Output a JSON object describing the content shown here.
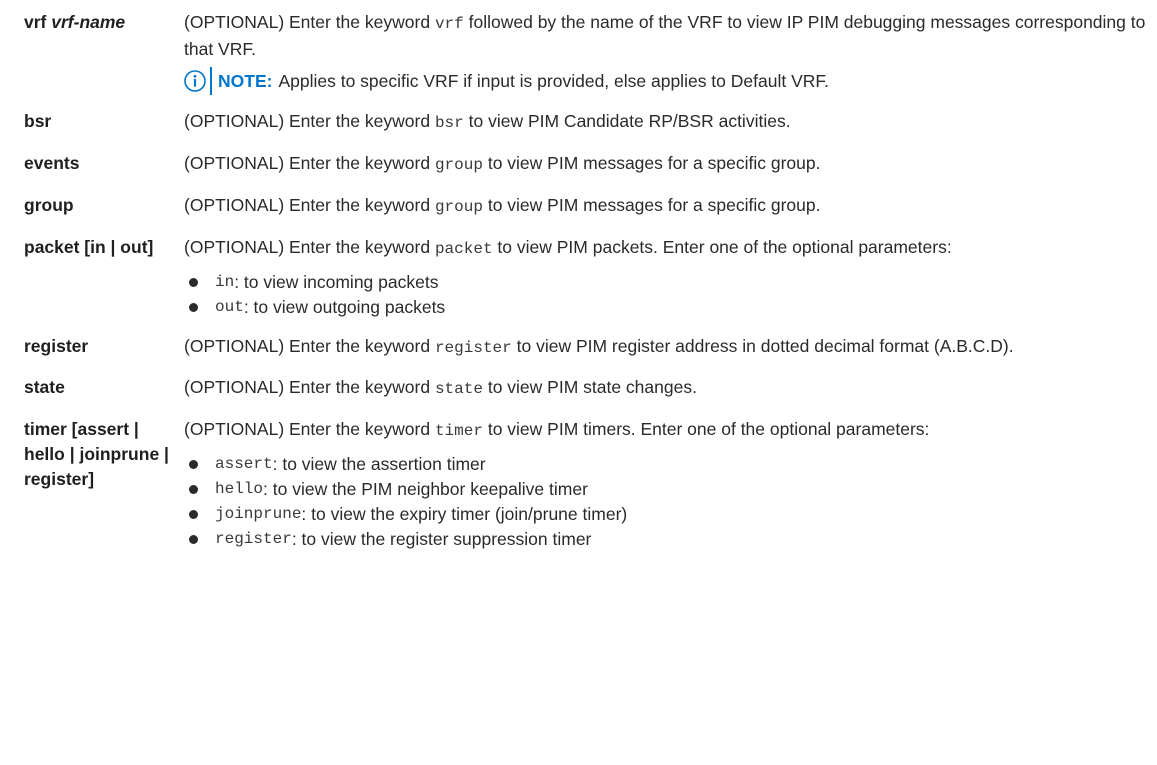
{
  "colors": {
    "note_accent": "#0076ce",
    "text": "#2a2a2a"
  },
  "rows": {
    "vrf": {
      "term_keyword": "vrf",
      "term_arg": "vrf-name",
      "desc_a": "(OPTIONAL) Enter the keyword",
      "desc_code": "vrf",
      "desc_b": "followed by the name of the VRF to view IP PIM debugging messages corresponding to that VRF.",
      "note_icon": "info-circle-icon",
      "note_label": "NOTE:",
      "note_text": "Applies to specific VRF if input is provided, else applies to Default VRF."
    },
    "bsr": {
      "term": "bsr",
      "desc_a": "(OPTIONAL) Enter the keyword",
      "desc_code": "bsr",
      "desc_b": "to view PIM Candidate RP/BSR activities."
    },
    "events": {
      "term": "events",
      "desc_a": "(OPTIONAL) Enter the keyword",
      "desc_code": "group",
      "desc_b": "to view PIM messages for a specific group."
    },
    "group": {
      "term": "group",
      "desc_a": "(OPTIONAL) Enter the keyword",
      "desc_code": "group",
      "desc_b": "to view PIM messages for a specific group."
    },
    "packet": {
      "term": "packet [in | out]",
      "desc_a": "(OPTIONAL) Enter the keyword",
      "desc_code": "packet",
      "desc_b": "to view PIM packets. Enter one of the optional parameters:",
      "options": [
        {
          "code": "in",
          "text": ": to view incoming packets"
        },
        {
          "code": "out",
          "text": ": to view outgoing packets"
        }
      ]
    },
    "register": {
      "term": "register",
      "desc_a": "(OPTIONAL) Enter the keyword",
      "desc_code": "register",
      "desc_b": "to view PIM register address in dotted decimal format (A.B.C.D)."
    },
    "state": {
      "term": "state",
      "desc_a": "(OPTIONAL) Enter the keyword",
      "desc_code": "state",
      "desc_b": "to view PIM state changes."
    },
    "timer": {
      "term_line1": "timer [assert |",
      "term_line2": "hello | joinprune |",
      "term_line3": "register]",
      "desc_a": "(OPTIONAL) Enter the keyword",
      "desc_code": "timer",
      "desc_b": "to view PIM timers. Enter one of the optional parameters:",
      "options": [
        {
          "code": "assert",
          "text": ": to view the assertion timer"
        },
        {
          "code": "hello",
          "text": ": to view the PIM neighbor keepalive timer"
        },
        {
          "code": "joinprune",
          "text": ": to view the expiry timer (join/prune timer)"
        },
        {
          "code": "register",
          "text": ": to view the register suppression timer"
        }
      ]
    }
  }
}
